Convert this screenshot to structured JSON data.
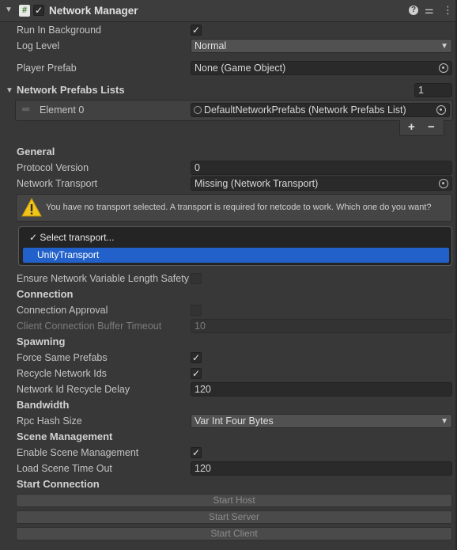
{
  "component": {
    "title": "Network Manager",
    "enabled": true
  },
  "fields": {
    "run_in_background": {
      "label": "Run In Background",
      "checked": true
    },
    "log_level": {
      "label": "Log Level",
      "value": "Normal"
    },
    "player_prefab": {
      "label": "Player Prefab",
      "value": "None (Game Object)"
    }
  },
  "prefab_lists": {
    "title": "Network Prefabs Lists",
    "count": "1",
    "element_label": "Element 0",
    "element_value": "DefaultNetworkPrefabs (Network Prefabs List)"
  },
  "general": {
    "title": "General",
    "protocol_version": {
      "label": "Protocol Version",
      "value": "0"
    },
    "network_transport": {
      "label": "Network Transport",
      "value": "Missing (Network Transport)"
    },
    "warning": "You have no transport selected. A transport is required for netcode to work. Which one do you want?",
    "transport_menu": {
      "options": [
        "Select transport...",
        "UnityTransport"
      ],
      "checked_index": 0,
      "highlighted_index": 1
    },
    "ensure_length_safety": {
      "label": "Ensure Network Variable Length Safety",
      "checked": false
    }
  },
  "connection": {
    "title": "Connection",
    "approval": {
      "label": "Connection Approval",
      "checked": false
    },
    "buffer_timeout": {
      "label": "Client Connection Buffer Timeout",
      "value": "10"
    }
  },
  "spawning": {
    "title": "Spawning",
    "force_same_prefabs": {
      "label": "Force Same Prefabs",
      "checked": true
    },
    "recycle_ids": {
      "label": "Recycle Network Ids",
      "checked": true
    },
    "recycle_delay": {
      "label": "Network Id Recycle Delay",
      "value": "120"
    }
  },
  "bandwidth": {
    "title": "Bandwidth",
    "rpc_hash_size": {
      "label": "Rpc Hash Size",
      "value": "Var Int Four Bytes"
    }
  },
  "scene_management": {
    "title": "Scene Management",
    "enable": {
      "label": "Enable Scene Management",
      "checked": true
    },
    "timeout": {
      "label": "Load Scene Time Out",
      "value": "120"
    }
  },
  "start_connection": {
    "title": "Start Connection",
    "buttons": [
      "Start Host",
      "Start Server",
      "Start Client"
    ]
  },
  "icons": {
    "foldout": "triangle-down",
    "script": "hash-script-icon",
    "help": "question-icon",
    "presets": "sliders-icon",
    "menu": "kebab-icon",
    "warning": "warning-triangle-icon"
  }
}
